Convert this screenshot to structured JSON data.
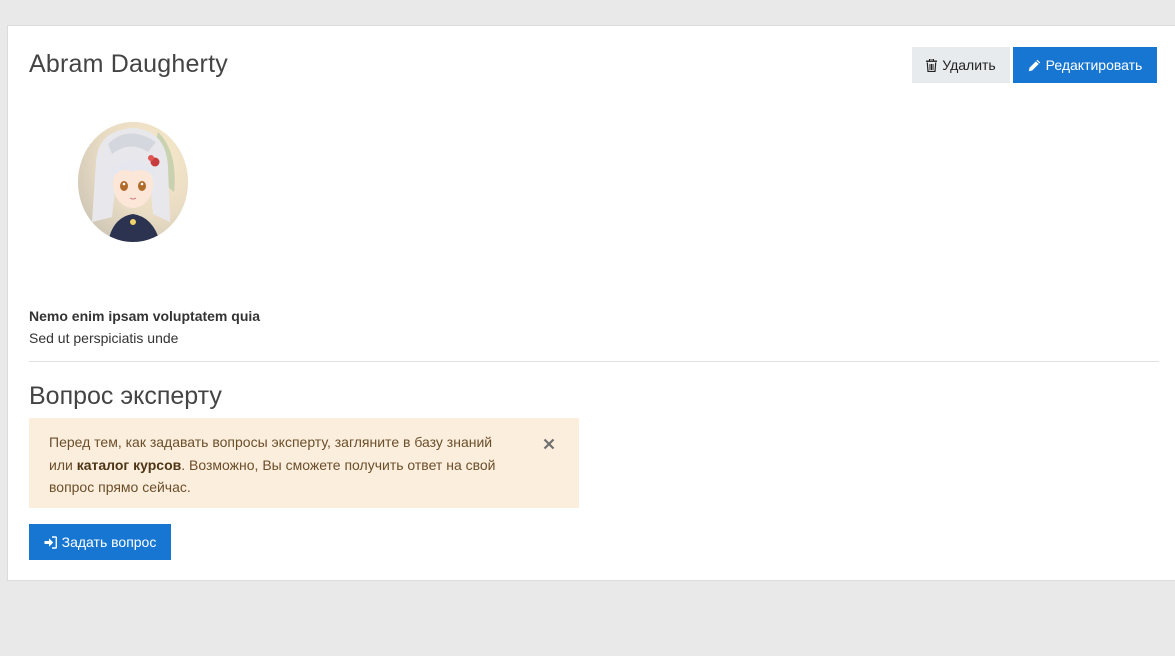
{
  "profile": {
    "name": "Abram Daugherty",
    "bio_title": "Nemo enim ipsam voluptatem quia",
    "bio_subtitle": "Sed ut perspiciatis unde"
  },
  "actions": {
    "delete_label": "Удалить",
    "edit_label": "Редактировать"
  },
  "expert": {
    "section_title": "Вопрос эксперту",
    "alert_before": "Перед тем, как задавать вопросы эксперту, загляните в базу знаний или ",
    "alert_link": "каталог курсов",
    "alert_after": ". Возможно, Вы сможете получить ответ на свой вопрос прямо сейчас.",
    "ask_label": "Задать вопрос"
  },
  "colors": {
    "primary": "#1676d2",
    "alert_bg": "#fbeedd",
    "delete_bg": "#e8ebee"
  },
  "icons": {
    "delete": "trash-icon",
    "edit": "pencil-icon",
    "ask": "sign-in-icon",
    "close": "close-icon"
  }
}
